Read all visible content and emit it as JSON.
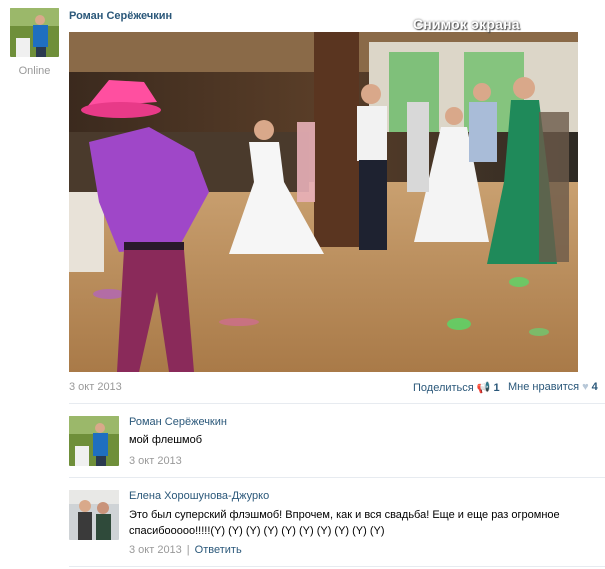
{
  "post": {
    "author": "Роман Серёжечкин",
    "status": "Online",
    "watermark": "Снимок экрана",
    "date": "3 окт 2013",
    "share_label": "Поделиться",
    "share_count": "1",
    "like_label": "Мне нравится",
    "like_count": "4"
  },
  "comments": [
    {
      "author": "Роман Серёжечкин",
      "text": "мой флешмоб",
      "date": "3 окт 2013"
    },
    {
      "author": "Елена Хорошунова-Джурко",
      "text_line1": "Это был суперский флэшмоб! Впрочем, как и вся свадьба! Еще и еще раз огромное",
      "text_line2": "спасибооооо!!!!!(Y) (Y) (Y) (Y) (Y) (Y) (Y) (Y) (Y) (Y)",
      "date": "3 окт 2013",
      "separator": "|",
      "reply_label": "Ответить"
    }
  ],
  "colors": {
    "link": "#2b587a",
    "muted": "#999999",
    "divider": "#e7ebf0"
  }
}
